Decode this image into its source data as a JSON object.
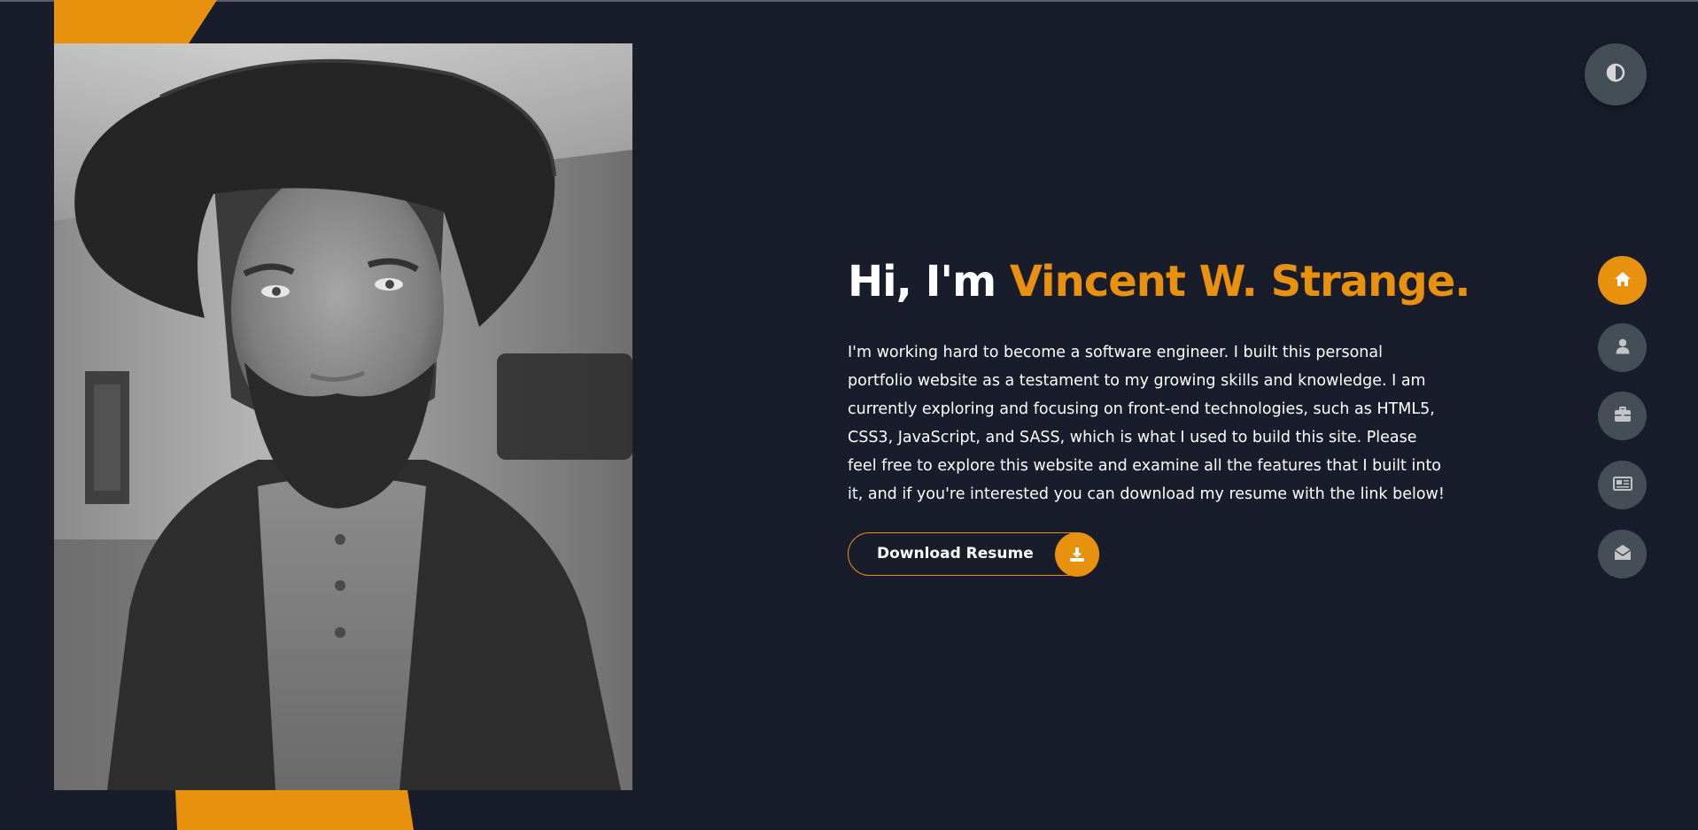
{
  "hero": {
    "greeting": "Hi, I'm ",
    "name": "Vincent W. Strange.",
    "description": "I'm working hard to become a software engineer. I built this personal portfolio website as a testament to my growing skills and knowledge. I am currently exploring and focusing on front-end technologies, such as HTML5, CSS3, JavaScript, and SASS, which is what I used to build this site. Please feel free to explore this website and examine all the features that I built into it, and if you're interested you can download my resume with the link below!",
    "download_label": "Download Resume",
    "download_icon": "download-icon"
  },
  "portrait": {
    "icon": "profile-photo"
  },
  "theme_toggle": {
    "icon": "contrast-icon"
  },
  "nav": {
    "items": [
      {
        "icon": "home-icon",
        "active": true
      },
      {
        "icon": "user-icon",
        "active": false
      },
      {
        "icon": "briefcase-icon",
        "active": false
      },
      {
        "icon": "newspaper-icon",
        "active": false
      },
      {
        "icon": "envelope-open-icon",
        "active": false
      }
    ]
  },
  "colors": {
    "background": "#191d2b",
    "accent": "#e8910f",
    "button_grey": "#454e56",
    "text": "#ffffff"
  }
}
